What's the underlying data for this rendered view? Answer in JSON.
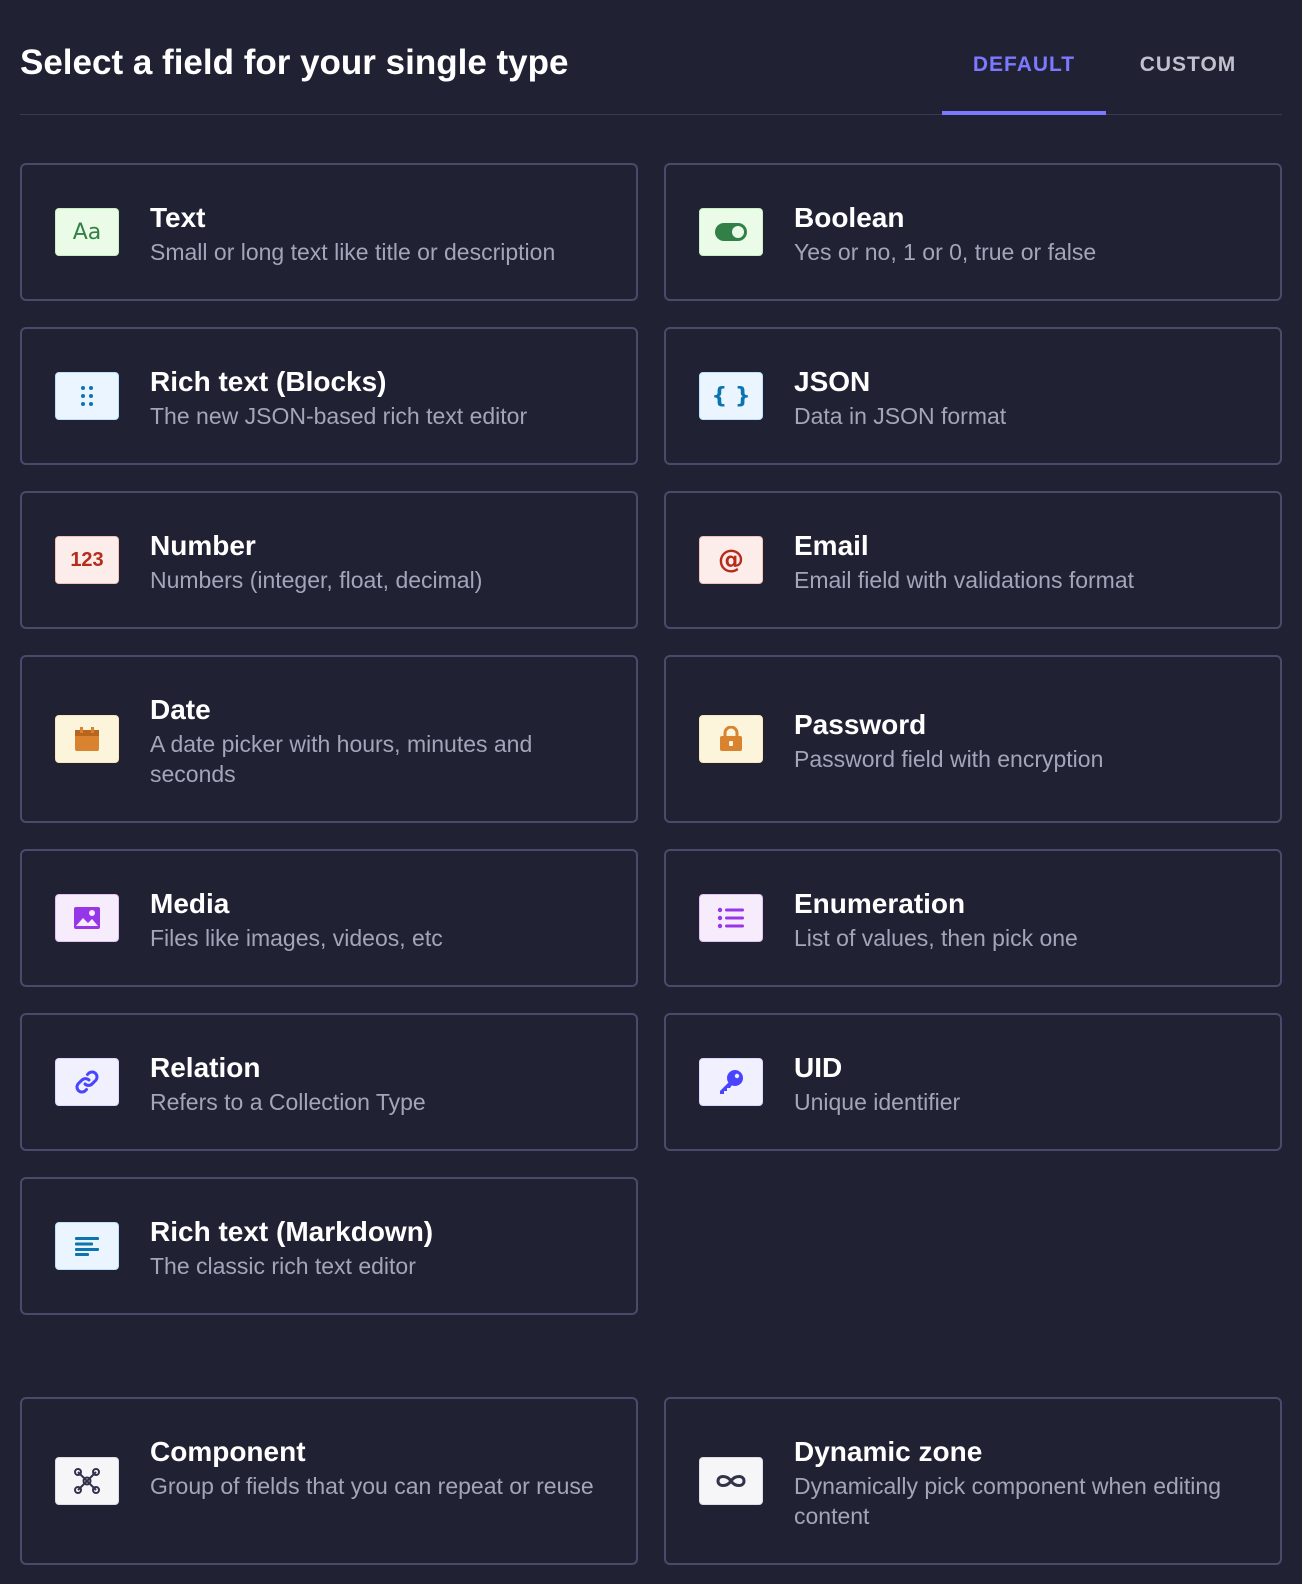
{
  "header": {
    "title": "Select a field for your single type",
    "tabs": [
      {
        "label": "DEFAULT",
        "active": true
      },
      {
        "label": "CUSTOM",
        "active": false
      }
    ]
  },
  "fields": [
    {
      "name": "Text",
      "description": "Small or long text like title or description",
      "icon": "text-aa-icon",
      "icon_glyph": "Aa"
    },
    {
      "name": "Boolean",
      "description": "Yes or no, 1 or 0, true or false",
      "icon": "toggle-icon"
    },
    {
      "name": "Rich text (Blocks)",
      "description": "The new JSON-based rich text editor",
      "icon": "drag-dots-icon"
    },
    {
      "name": "JSON",
      "description": "Data in JSON format",
      "icon": "curly-braces-icon",
      "icon_glyph": "{ }"
    },
    {
      "name": "Number",
      "description": "Numbers (integer, float, decimal)",
      "icon": "number-icon",
      "icon_glyph": "123"
    },
    {
      "name": "Email",
      "description": "Email field with validations format",
      "icon": "at-sign-icon",
      "icon_glyph": "@"
    },
    {
      "name": "Date",
      "description": "A date picker with hours, minutes and seconds",
      "icon": "calendar-icon"
    },
    {
      "name": "Password",
      "description": "Password field with encryption",
      "icon": "lock-icon"
    },
    {
      "name": "Media",
      "description": "Files like images, videos, etc",
      "icon": "image-icon"
    },
    {
      "name": "Enumeration",
      "description": "List of values, then pick one",
      "icon": "bullet-list-icon"
    },
    {
      "name": "Relation",
      "description": "Refers to a Collection Type",
      "icon": "link-icon"
    },
    {
      "name": "UID",
      "description": "Unique identifier",
      "icon": "key-icon"
    },
    {
      "name": "Rich text (Markdown)",
      "description": "The classic rich text editor",
      "icon": "paragraph-icon"
    }
  ],
  "special_fields": [
    {
      "name": "Component",
      "description": "Group of fields that you can repeat or reuse",
      "icon": "component-icon"
    },
    {
      "name": "Dynamic zone",
      "description": "Dynamically pick component when editing content",
      "icon": "infinity-icon"
    }
  ],
  "colors": {
    "background": "#212134",
    "accent": "#7b79ff",
    "card_border": "#4a4a6a"
  }
}
